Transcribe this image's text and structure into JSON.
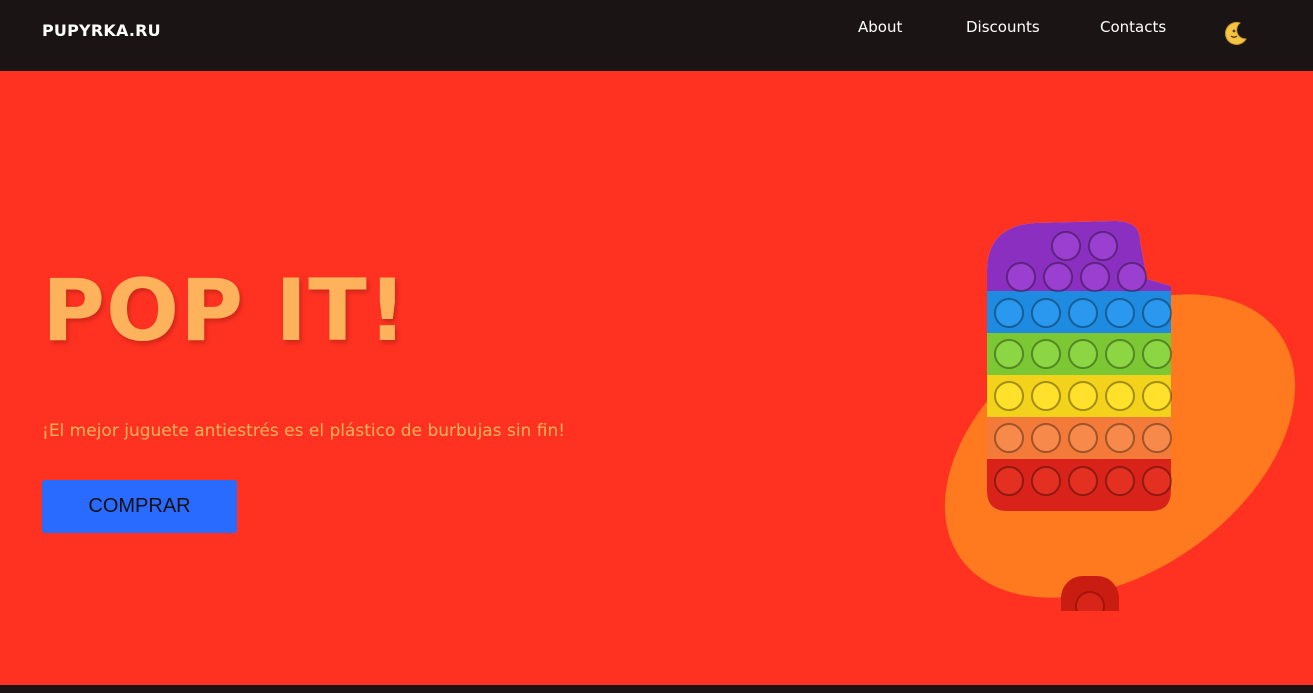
{
  "header": {
    "logo": "PUPYRKA.RU",
    "nav": [
      "About",
      "Discounts",
      "Contacts"
    ],
    "theme_toggle_icon": "moon-face-icon"
  },
  "hero": {
    "title": "POP IT!",
    "subtitle": "¡El mejor juguete antiestrés es el plástico de burbujas sin fin!",
    "button": "COMPRAR",
    "image": "rainbow-popsicle-pop-it-image"
  },
  "colors": {
    "topbar": "#1b1414",
    "hero_bg": "#ff3222",
    "accent_text": "#ffb25c",
    "button": "#2a6bff",
    "blob": "#ff7a1e"
  }
}
